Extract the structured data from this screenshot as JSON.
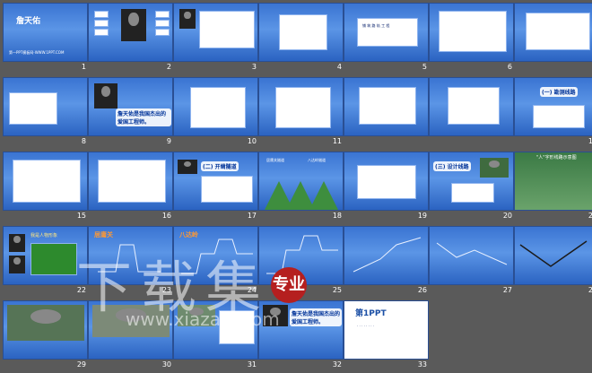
{
  "slides": [
    {
      "n": "1",
      "title": "詹天佑",
      "caption": "第一PPT模板网-WWW.1PPT.COM"
    },
    {
      "n": "2"
    },
    {
      "n": "3"
    },
    {
      "n": "4"
    },
    {
      "n": "5",
      "box_text": "铺 筑 路 轨 工 程"
    },
    {
      "n": "6"
    },
    {
      "n": "7"
    },
    {
      "n": "8"
    },
    {
      "n": "9",
      "heading": "詹天佑是我国杰出的爱国工程师。"
    },
    {
      "n": "10"
    },
    {
      "n": "11"
    },
    {
      "n": "12",
      "heading": "(一) 勘测线路"
    },
    {
      "n": "15"
    },
    {
      "n": "16"
    },
    {
      "n": "17",
      "heading": "(二) 开凿隧道"
    },
    {
      "n": "18",
      "left_label": "居庸关隧道",
      "right_label": "八达岭隧道"
    },
    {
      "n": "19"
    },
    {
      "n": "20",
      "heading": "(三) 设计线路"
    },
    {
      "n": "21",
      "heading": "\"人\"字形线路示意图"
    },
    {
      "n": "22",
      "label": "我是人物形象"
    },
    {
      "n": "23",
      "label": "居庸关"
    },
    {
      "n": "24",
      "label": "八达岭"
    },
    {
      "n": "25"
    },
    {
      "n": "26"
    },
    {
      "n": "27"
    },
    {
      "n": "28"
    },
    {
      "n": "29"
    },
    {
      "n": "30"
    },
    {
      "n": "31"
    },
    {
      "n": "32",
      "heading": "詹天佑是我国杰出的爱国工程师。"
    },
    {
      "n": "33",
      "heading": "第1PPT"
    }
  ],
  "watermark": {
    "text": "下载集",
    "url": "www.xiazaiji.com",
    "seal": "专业"
  }
}
